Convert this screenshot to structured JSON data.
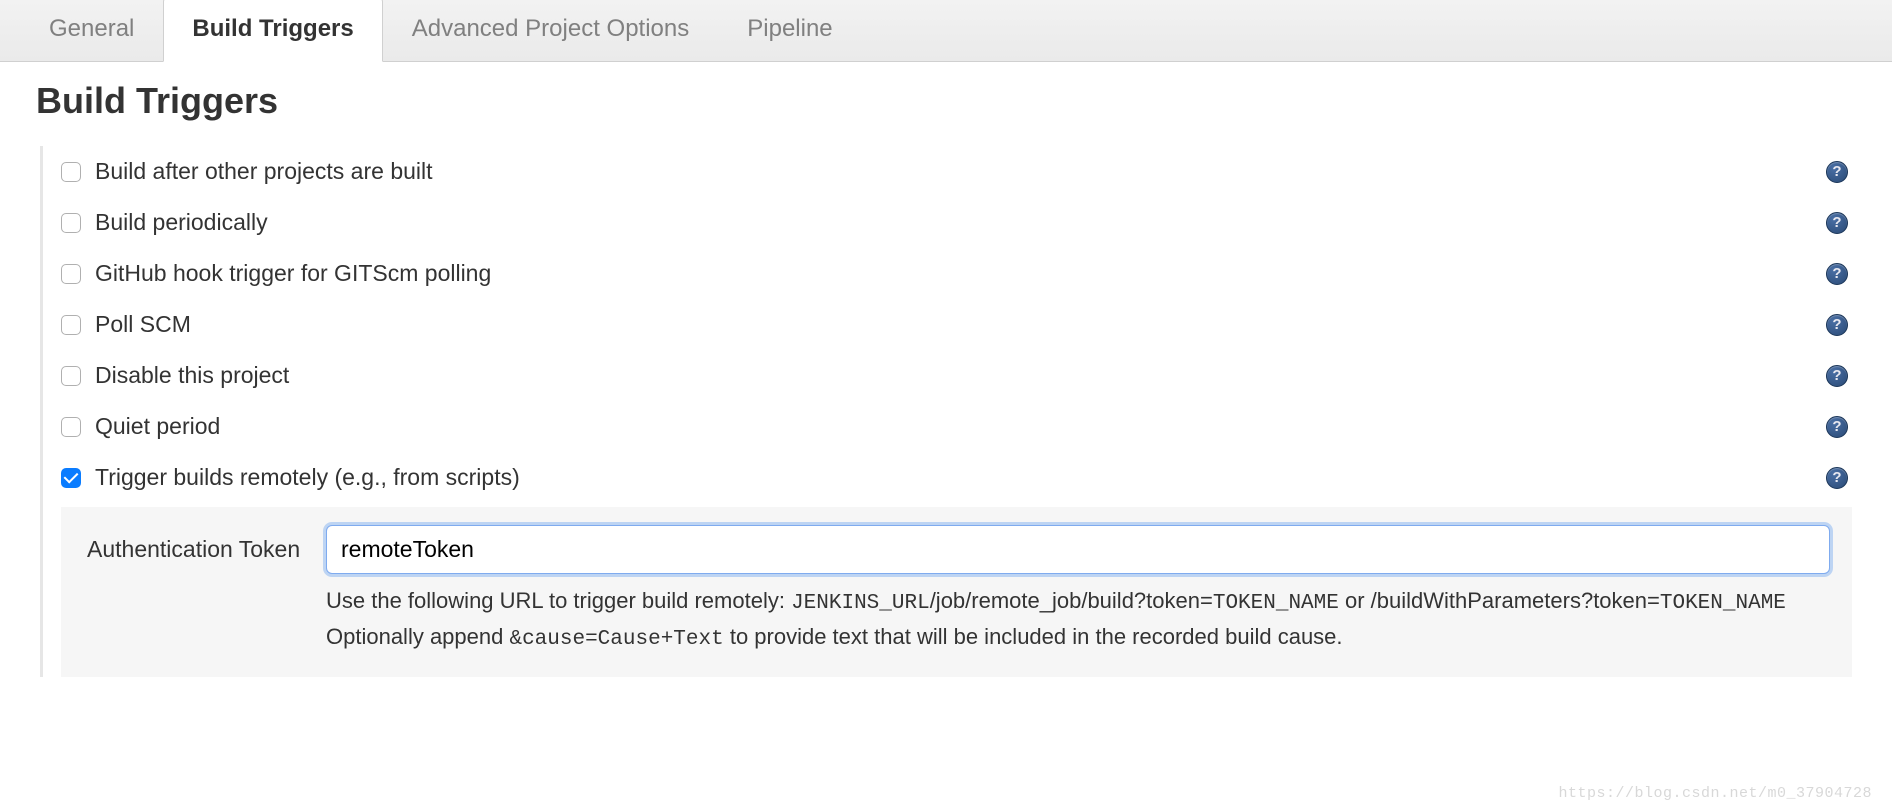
{
  "tabs": [
    {
      "label": "General",
      "active": false
    },
    {
      "label": "Build Triggers",
      "active": true
    },
    {
      "label": "Advanced Project Options",
      "active": false
    },
    {
      "label": "Pipeline",
      "active": false
    }
  ],
  "section": {
    "title": "Build Triggers"
  },
  "triggers": [
    {
      "label": "Build after other projects are built",
      "checked": false
    },
    {
      "label": "Build periodically",
      "checked": false
    },
    {
      "label": "GitHub hook trigger for GITScm polling",
      "checked": false
    },
    {
      "label": "Poll SCM",
      "checked": false
    },
    {
      "label": "Disable this project",
      "checked": false
    },
    {
      "label": "Quiet period",
      "checked": false
    },
    {
      "label": "Trigger builds remotely (e.g., from scripts)",
      "checked": true
    }
  ],
  "auth": {
    "label": "Authentication Token",
    "value": "remoteToken",
    "help_line1a": "Use the following URL to trigger build remotely: ",
    "help_line1b": "JENKINS_URL",
    "help_line1c": "/job/remote_job/build?token=",
    "help_line1d": "TOKEN_NAME",
    "help_line1e": " or /buildWithParameters?token=",
    "help_line1f": "TOKEN_NAME",
    "help_line2a": "Optionally append ",
    "help_line2b": "&cause=Cause+Text",
    "help_line2c": " to provide text that will be included in the recorded build cause."
  },
  "watermark": "https://blog.csdn.net/m0_37904728"
}
